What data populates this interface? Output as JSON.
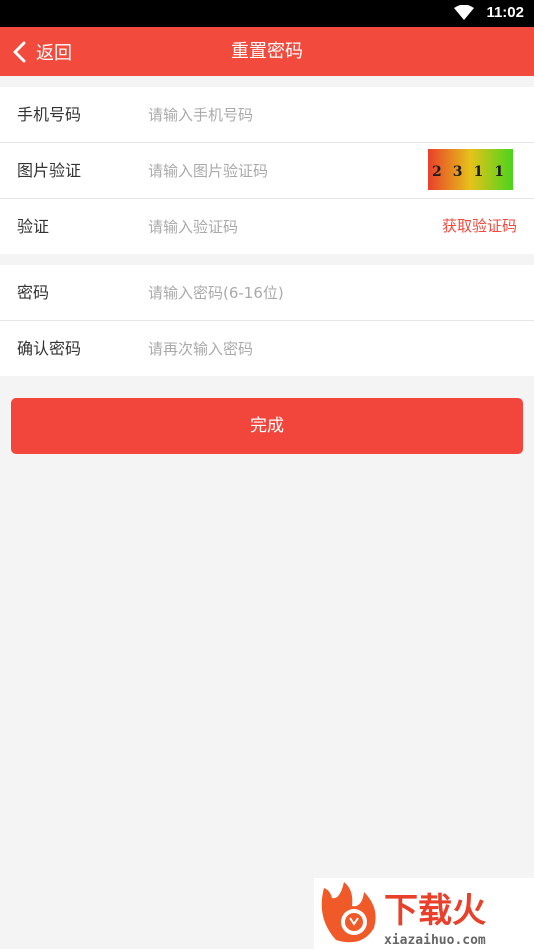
{
  "status_bar": {
    "time": "11:02",
    "icons": [
      "wifi-icon"
    ]
  },
  "app_bar": {
    "back_label": "返回",
    "title": "重置密码",
    "back_icon": "chevron-left-icon"
  },
  "form": {
    "phone": {
      "label": "手机号码",
      "placeholder": "请输入手机号码"
    },
    "image_captcha": {
      "label": "图片验证",
      "placeholder": "请输入图片验证码",
      "captcha_text": "2311"
    },
    "sms_code": {
      "label": "验证",
      "placeholder": "请输入验证码",
      "get_code_label": "获取验证码"
    },
    "password": {
      "label": "密码",
      "placeholder": "请输入密码(6-16位)"
    },
    "confirm_password": {
      "label": "确认密码",
      "placeholder": "请再次输入密码"
    }
  },
  "submit_label": "完成",
  "watermark": {
    "brand": "下载火",
    "domain": "xiazaihuo.com"
  },
  "colors": {
    "accent": "#f24a3d",
    "background": "#f4f4f4",
    "placeholder": "#aaaaaa"
  }
}
